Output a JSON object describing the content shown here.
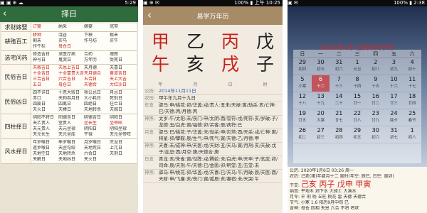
{
  "panel1": {
    "status_left": "▣ ▣ ⊕ ☁",
    "status_time": "5:29",
    "title": "择日",
    "back": "‹",
    "rows": [
      {
        "cat": "求财嫁娶",
        "items": [
          {
            "t": "订盟",
            "c": "red"
          },
          {
            "t": "纳采",
            "c": "blk"
          },
          {
            "t": "嫁娶",
            "c": "blk"
          },
          {
            "t": "冠带",
            "c": "blk"
          }
        ]
      },
      {
        "cat": "耕殖百工",
        "items": [
          {
            "t": "耕种",
            "c": "red"
          },
          {
            "t": "浇谷",
            "c": "blk"
          },
          {
            "t": "下秧",
            "c": "blk"
          },
          {
            "t": "栽禾",
            "c": "blk"
          },
          {
            "t": "割禾",
            "c": "blk"
          },
          {
            "t": "买马",
            "c": "blk"
          },
          {
            "t": "作马坊",
            "c": "blk"
          },
          {
            "t": "买牛",
            "c": "blk"
          },
          {
            "t": "作牛栏",
            "c": "blk"
          },
          {
            "t": "母仓日",
            "c": "red"
          }
        ]
      },
      {
        "cat": "选宅问药",
        "items": [
          {
            "t": "修造吉日",
            "c": "blk"
          },
          {
            "t": "求医疗病",
            "c": "blk"
          },
          {
            "t": "合药",
            "c": "blk"
          },
          {
            "t": "埋葬",
            "c": "blk"
          },
          {
            "t": "神号日",
            "c": "blk"
          },
          {
            "t": "鬼哭日",
            "c": "blk"
          },
          {
            "t": "万年历",
            "c": "blk"
          },
          {
            "t": "受死日",
            "c": "blk"
          }
        ]
      },
      {
        "cat": "民俗吉日",
        "items": [
          {
            "t": "天赦吉日",
            "c": "red"
          },
          {
            "t": "天恩上吉日",
            "c": "red"
          },
          {
            "t": "天月德",
            "c": "blk"
          },
          {
            "t": "天喜日",
            "c": "blk"
          },
          {
            "t": "十全吉日",
            "c": "red"
          },
          {
            "t": "十全富贵大吉",
            "c": "red"
          },
          {
            "t": "天月德合",
            "c": "red"
          },
          {
            "t": "黄道吉日",
            "c": "red"
          },
          {
            "t": "三合吉日",
            "c": "red"
          },
          {
            "t": "六合吉日",
            "c": "red"
          },
          {
            "t": "五合日",
            "c": "red"
          },
          {
            "t": "天上大吉",
            "c": "red"
          },
          {
            "t": "五日",
            "c": "red"
          },
          {
            "t": "母仓日",
            "c": "red"
          },
          {
            "t": "天德合",
            "c": "red"
          },
          {
            "t": "大红沙日",
            "c": "red"
          }
        ]
      },
      {
        "cat": "民俗凶日",
        "items": [
          {
            "t": "四不详日",
            "c": "blk"
          },
          {
            "t": "十恶大败日",
            "c": "blk"
          },
          {
            "t": "杨公忌日",
            "c": "blk"
          },
          {
            "t": "月忌日",
            "c": "blk"
          },
          {
            "t": "赤口",
            "c": "blk"
          },
          {
            "t": "天狗吞月日",
            "c": "blk"
          },
          {
            "t": "大小耗日",
            "c": "blk"
          },
          {
            "t": "死别日",
            "c": "blk"
          },
          {
            "t": "四废日",
            "c": "blk"
          },
          {
            "t": "四离日",
            "c": "blk"
          },
          {
            "t": "四绝日",
            "c": "blk"
          },
          {
            "t": "往亡日",
            "c": "blk"
          },
          {
            "t": "天火日",
            "c": "blk"
          },
          {
            "t": "天棒日",
            "c": "blk"
          },
          {
            "t": "天地转杀",
            "c": "blk"
          },
          {
            "t": "天贼日",
            "c": "blk"
          }
        ]
      },
      {
        "cat": "四柱择日",
        "items": [
          {
            "t": "阴阳不将日",
            "c": "blk"
          },
          {
            "t": "阳德吉日",
            "c": "blk"
          },
          {
            "t": "阴德吉日",
            "c": "blk"
          },
          {
            "t": "阴阳日",
            "c": "blk"
          },
          {
            "t": "天乙贵人",
            "c": "blk"
          },
          {
            "t": "堂贵人",
            "c": "blk"
          },
          {
            "t": "坐长生",
            "c": "red"
          },
          {
            "t": "坐帝旺",
            "c": "red"
          },
          {
            "t": "天元贵人",
            "c": "blk"
          },
          {
            "t": "天元坐禄",
            "c": "blk"
          },
          {
            "t": "阴阳日",
            "c": "blk"
          },
          {
            "t": "阴阳坐禄",
            "c": "blk"
          },
          {
            "t": "天元长生",
            "c": "blk"
          },
          {
            "t": "天元坐库",
            "c": "blk"
          },
          {
            "t": "干禄",
            "c": "blk"
          },
          {
            "t": "天元坐帝旺",
            "c": "blk"
          }
        ]
      },
      {
        "cat": "风水择日",
        "items": [
          {
            "t": "年罗喉日",
            "c": "blk"
          },
          {
            "t": "季罗喉日",
            "c": "blk"
          },
          {
            "t": "月罗喉日",
            "c": "blk"
          },
          {
            "t": "灭没日",
            "c": "blk"
          },
          {
            "t": "逐罗喉日",
            "c": "blk"
          },
          {
            "t": "天罡勾绞",
            "c": "blk"
          },
          {
            "t": "天地荒日",
            "c": "blk"
          },
          {
            "t": "上兀日",
            "c": "blk"
          },
          {
            "t": "天地空日",
            "c": "blk"
          },
          {
            "t": "天地转杀",
            "c": "blk"
          },
          {
            "t": "六合日",
            "c": "blk"
          },
          {
            "t": "天刑日",
            "c": "blk"
          },
          {
            "t": "天解日",
            "c": "blk"
          },
          {
            "t": "天地凶日",
            "c": "blk"
          },
          {
            "t": "天火日",
            "c": "blk"
          }
        ]
      }
    ]
  },
  "panel2": {
    "status_left": "▣ ⊕ ✉",
    "status_right": "100% ▮ 上午 10:25",
    "title": "易学万年历",
    "back": "‹",
    "gz_top": [
      "甲",
      "乙",
      "丙",
      "戊"
    ],
    "gz_bottom": [
      "午",
      "亥",
      "戌",
      "子"
    ],
    "gz_top_colors": [
      "#c8201a",
      "#222222",
      "#c8201a",
      "#222222"
    ],
    "gz_bottom_colors": [
      "#c8201a",
      "#222222",
      "#c8201a",
      "#222222"
    ],
    "labels": [
      "年",
      "月",
      "日",
      "时"
    ],
    "rows": [
      {
        "k": "公历:",
        "v": "2014年11月11日"
      },
      {
        "k": "农历:",
        "v": "甲午年九月十九日"
      },
      {
        "k": "年支",
        "v": "驿马:申/桃花:卯/华盖:戌/贵人:丑未/天禄:寅/劫杀:亥/亡神:巳/天德:丙/月德:丙"
      },
      {
        "k": "神煞:",
        "v": "太岁:午/太阳:未/丧门:申/太阴:酉/官符:戌/死符:亥/岁破:子/龙德:丑/白虎:寅/福德:卯/吊客:辰/病符:巳"
      },
      {
        "k": "月支",
        "v": "驿马:巳/桃花:子/华盖:未/劫杀:申/灾煞:酉/天杀:戌/亡神:寅/将星:卯/攀鞍:辰/生气:申/死气:寅/天德:乙/月德:甲"
      },
      {
        "k": "神煞:",
        "v": "天喜:未/成神:申/天医:戌/天财:丑/天马:寅/月刑:亥/天赦:戊子/血忌:酉/月空:庚/天德合:庚"
      },
      {
        "k": "日支",
        "v": "青龙:亥/朱雀:寅/勾陈:戌/腾蛇:未/白虎:申/天牢:子/玄武:卯/司命:辰/天刑:午/天德:巳/金匮:卯/明堂:丑/玉堂:未"
      },
      {
        "k": "神煞:",
        "v": "驿马:申/桃花:卯/华盖:戌/天喜:巳/天马:午/月破:辰/天医:酉/天财:申/飞廉:亥/丧门:寅/孤辰:亥/寡宿:未/天哭:午"
      }
    ]
  },
  "panel3": {
    "status_left": "▣ ✉",
    "status_right": "100% ▮ 2:38",
    "month_title": "2020年1月  己亥年丙子月",
    "weekdays": [
      "日",
      "一",
      "二",
      "三",
      "四",
      "五",
      "六"
    ],
    "weeks": [
      [
        {
          "d": "29",
          "l": "初四"
        },
        {
          "d": "30",
          "l": "初五"
        },
        {
          "d": "31",
          "l": "初六"
        },
        {
          "d": "1",
          "l": "元旦"
        },
        {
          "d": "2",
          "l": "初八"
        },
        {
          "d": "3",
          "l": "初九"
        },
        {
          "d": "4",
          "l": "初十"
        }
      ],
      [
        {
          "d": "5",
          "l": "小寒"
        },
        {
          "d": "6",
          "l": "十二"
        },
        {
          "d": "7",
          "l": "十三"
        },
        {
          "d": "8",
          "l": "十四"
        },
        {
          "d": "9",
          "l": "十五"
        },
        {
          "d": "10",
          "l": "十六"
        },
        {
          "d": "11",
          "l": "十七"
        }
      ],
      [
        {
          "d": "12",
          "l": "十八"
        },
        {
          "d": "13",
          "l": "十九"
        },
        {
          "d": "14",
          "l": "二十"
        },
        {
          "d": "15",
          "l": "廿一"
        },
        {
          "d": "16",
          "l": "廿二"
        },
        {
          "d": "17",
          "l": "廿三"
        },
        {
          "d": "18",
          "l": "廿四"
        }
      ],
      [
        {
          "d": "19",
          "l": "廿五"
        },
        {
          "d": "20",
          "l": "大寒"
        },
        {
          "d": "21",
          "l": "廿七"
        },
        {
          "d": "22",
          "l": "廿八"
        },
        {
          "d": "23",
          "l": "廿九"
        },
        {
          "d": "24",
          "l": "除夕"
        },
        {
          "d": "25",
          "l": "春节"
        }
      ],
      [
        {
          "d": "26",
          "l": "初二"
        },
        {
          "d": "27",
          "l": "初三"
        },
        {
          "d": "28",
          "l": "初四"
        },
        {
          "d": "29",
          "l": "初五"
        },
        {
          "d": "30",
          "l": "初六"
        },
        {
          "d": "31",
          "l": "初七"
        },
        {
          "d": "1",
          "l": "初八"
        }
      ]
    ],
    "selected": "6",
    "bottom_lines": [
      {
        "k": "公历:",
        "v": "2020年1月6日 03:26 周一"
      },
      {
        "k": "农历:",
        "v": "己亥(猪)年腊月十二 寅时(年空: 辰巳, 日空: 寅卯)"
      }
    ],
    "gz_label": "干支:",
    "gz": "己亥 丙子 戊申 甲寅",
    "nayin_line": "纳音: 平地木 涧下水 大驿土 大溪水",
    "extra_lines": [
      "月令: 辛 刑 杨 五柱 桃花 雷 天德 天德合",
      "节气: 小寒 1.6 阳历9月中旬 巳",
      "吉神: 母仓 四相 天恩 六合 不将 鸣吠"
    ]
  }
}
